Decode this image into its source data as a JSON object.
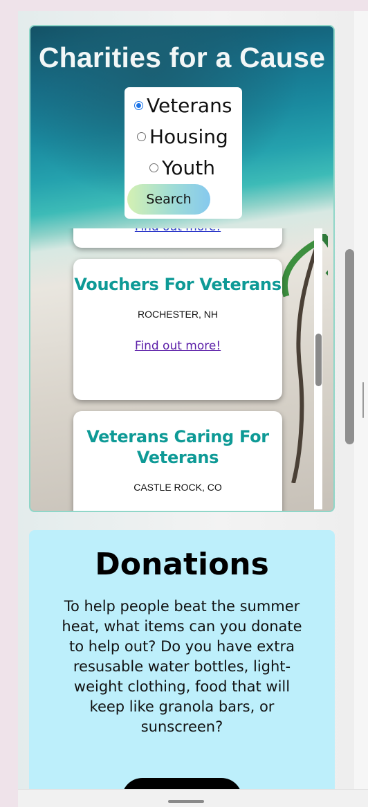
{
  "hero": {
    "title": "Charities for a Cause",
    "filters": [
      {
        "label": "Veterans",
        "checked": true
      },
      {
        "label": "Housing",
        "checked": false
      },
      {
        "label": "Youth",
        "checked": false
      }
    ],
    "search_label": "Search"
  },
  "results": {
    "partial_top": {
      "link": "Find out more!"
    },
    "cards": [
      {
        "title": "Vouchers For Veterans",
        "location": "ROCHESTER, NH",
        "link": "Find out more!"
      },
      {
        "title": "Veterans Caring For Veterans",
        "location": "CASTLE ROCK, CO",
        "link": ""
      }
    ]
  },
  "donations": {
    "title": "Donations",
    "text": "To help people beat the summer heat, what items can you donate to help out? Do you have extra resusable water bottles, light-weight clothing, food that will keep like granola bars, or sunscreen?"
  },
  "colors": {
    "accent_teal": "#0e9a96",
    "donations_bg": "#bdeffb",
    "link_visited": "#5b1fa8"
  }
}
